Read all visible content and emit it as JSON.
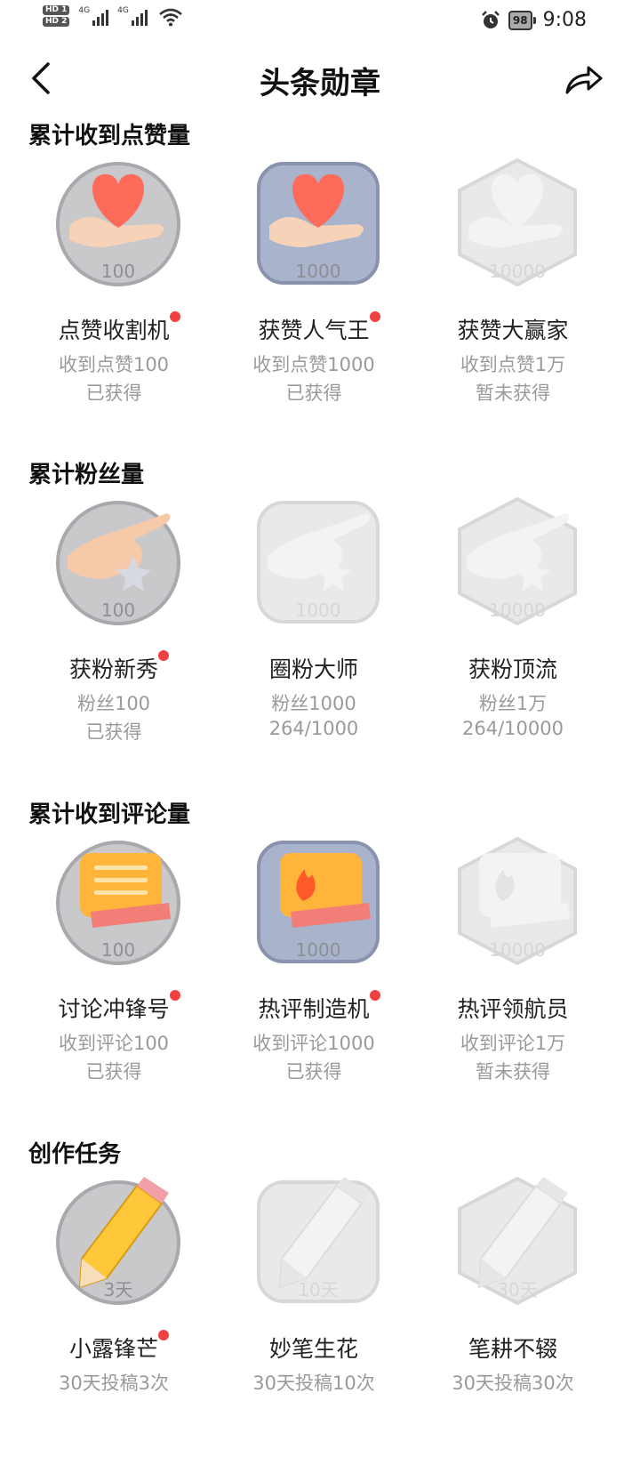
{
  "status_bar": {
    "hd1": "HD 1",
    "hd2": "HD 2",
    "net1": "4G",
    "net2": "4G",
    "battery": "98",
    "time": "9:08"
  },
  "nav": {
    "title": "头条勋章"
  },
  "sections": [
    {
      "title": "累计收到点赞量",
      "badges": [
        {
          "name": "点赞收割机",
          "line1": "收到点赞100",
          "line2": "已获得",
          "medal": "100",
          "dot": true,
          "earned": true,
          "art": "heart"
        },
        {
          "name": "获赞人气王",
          "line1": "收到点赞1000",
          "line2": "已获得",
          "medal": "1000",
          "dot": true,
          "earned": true,
          "art": "heart"
        },
        {
          "name": "获赞大赢家",
          "line1": "收到点赞1万",
          "line2": "暂未获得",
          "medal": "10000",
          "dot": false,
          "earned": false,
          "art": "heart"
        }
      ]
    },
    {
      "title": "累计粉丝量",
      "badges": [
        {
          "name": "获粉新秀",
          "line1": "粉丝100",
          "line2": "已获得",
          "medal": "100",
          "dot": true,
          "earned": true,
          "art": "hand"
        },
        {
          "name": "圈粉大师",
          "line1": "粉丝1000",
          "line2": "264/1000",
          "medal": "1000",
          "dot": false,
          "earned": false,
          "art": "hand"
        },
        {
          "name": "获粉顶流",
          "line1": "粉丝1万",
          "line2": "264/10000",
          "medal": "10000",
          "dot": false,
          "earned": false,
          "art": "hand"
        }
      ]
    },
    {
      "title": "累计收到评论量",
      "badges": [
        {
          "name": "讨论冲锋号",
          "line1": "收到评论100",
          "line2": "已获得",
          "medal": "100",
          "dot": true,
          "earned": true,
          "art": "comment"
        },
        {
          "name": "热评制造机",
          "line1": "收到评论1000",
          "line2": "已获得",
          "medal": "1000",
          "dot": true,
          "earned": true,
          "art": "comment"
        },
        {
          "name": "热评领航员",
          "line1": "收到评论1万",
          "line2": "暂未获得",
          "medal": "10000",
          "dot": false,
          "earned": false,
          "art": "comment"
        }
      ]
    },
    {
      "title": "创作任务",
      "badges": [
        {
          "name": "小露锋芒",
          "line1": "30天投稿3次",
          "line2": "",
          "medal": "3天",
          "dot": true,
          "earned": true,
          "art": "pencil"
        },
        {
          "name": "妙笔生花",
          "line1": "30天投稿10次",
          "line2": "",
          "medal": "10天",
          "dot": false,
          "earned": false,
          "art": "pencil"
        },
        {
          "name": "笔耕不辍",
          "line1": "30天投稿30次",
          "line2": "",
          "medal": "30天",
          "dot": false,
          "earned": false,
          "art": "pencil"
        }
      ]
    }
  ],
  "colors": {
    "dot": "#f04142",
    "grey_text": "#9a9a9a"
  }
}
